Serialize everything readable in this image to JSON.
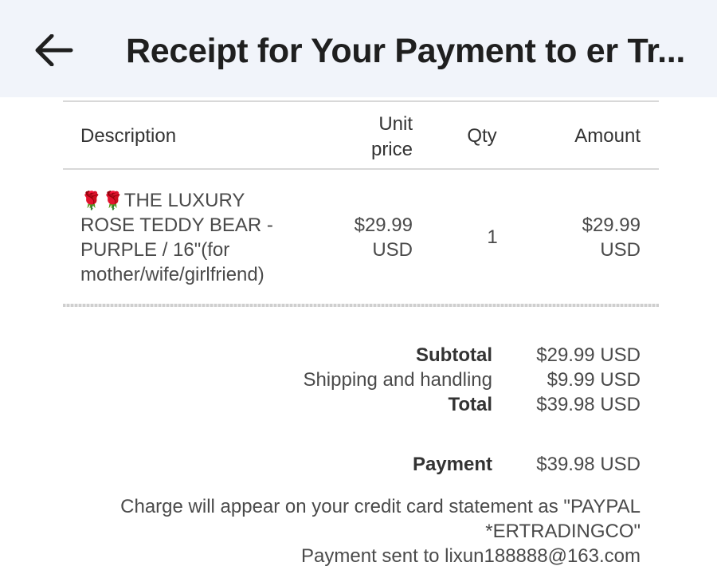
{
  "header": {
    "back_icon": "arrow-left-icon",
    "title": "Receipt for Your Payment to er Tr..."
  },
  "table": {
    "columns": {
      "description": "Description",
      "unit_price_line1": "Unit",
      "unit_price_line2": "price",
      "qty": "Qty",
      "amount": "Amount"
    },
    "items": [
      {
        "rose_icons": "🌹🌹",
        "description_lines": [
          "THE LUXURY",
          "ROSE TEDDY BEAR -",
          "PURPLE / 16\"(for",
          "mother/wife/girlfriend)"
        ],
        "unit_price": "$29.99",
        "unit_price_currency": "USD",
        "qty": "1",
        "amount": "$29.99",
        "amount_currency": "USD"
      }
    ]
  },
  "summary": {
    "subtotal_label": "Subtotal",
    "subtotal_value": "$29.99 USD",
    "shipping_label": "Shipping and handling",
    "shipping_value": "$9.99 USD",
    "total_label": "Total",
    "total_value": "$39.98 USD",
    "payment_label": "Payment",
    "payment_value": "$39.98 USD"
  },
  "footer": {
    "statement_line1": "Charge will appear on your credit card statement as \"PAYPAL",
    "statement_line2": "*ERTRADINGCO\"",
    "sent_to": "Payment sent to lixun188888@163.com"
  }
}
